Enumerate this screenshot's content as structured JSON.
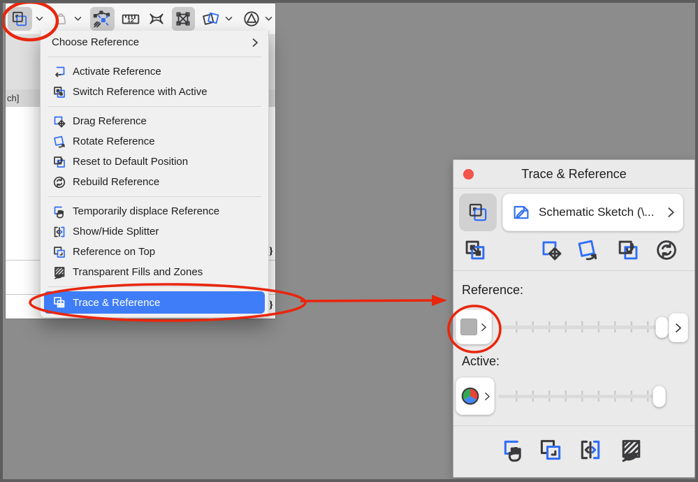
{
  "toolbar": {
    "buttons": [
      {
        "icon": "trace-reference-icon",
        "pressed": true
      },
      {
        "icon": "chevron-down-icon"
      },
      {
        "icon": "gravity-weight-icon",
        "disabled": true
      },
      {
        "icon": "chevron-down-icon"
      },
      {
        "icon": "virtual-trace-icon",
        "pressed": true
      },
      {
        "icon": "measure-icon",
        "measure_label": "12"
      },
      {
        "icon": "marquee-icon"
      },
      {
        "icon": "edit-handles-icon",
        "pressed": true
      },
      {
        "icon": "rotated-squares-icon"
      },
      {
        "icon": "chevron-down-icon"
      },
      {
        "icon": "orientation-circle-triangle-icon"
      },
      {
        "icon": "chevron-down-icon"
      }
    ],
    "measure_label": "12"
  },
  "canvas": {
    "tab_label": "ch]",
    "clipped_glyph_1": "}",
    "clipped_glyph_2": "}"
  },
  "menu": {
    "items": [
      {
        "label": "Choose Reference",
        "has_submenu": true
      },
      {
        "label": "Activate Reference",
        "icon": "activate-reference-icon"
      },
      {
        "label": "Switch Reference with Active",
        "icon": "switch-reference-icon"
      },
      {
        "label": "Drag Reference",
        "icon": "drag-reference-icon"
      },
      {
        "label": "Rotate Reference",
        "icon": "rotate-reference-icon"
      },
      {
        "label": "Reset to Default Position",
        "icon": "reset-position-icon"
      },
      {
        "label": "Rebuild Reference",
        "icon": "rebuild-reference-icon"
      },
      {
        "label": "Temporarily displace Reference",
        "icon": "displace-reference-icon"
      },
      {
        "label": "Show/Hide Splitter",
        "icon": "splitter-icon"
      },
      {
        "label": "Reference on Top",
        "icon": "reference-on-top-icon"
      },
      {
        "label": "Transparent Fills and Zones",
        "icon": "transparent-fills-icon"
      },
      {
        "label": "Trace & Reference",
        "icon": "trace-reference-icon",
        "highlighted": true
      }
    ],
    "highlight_color": "#3e7df7"
  },
  "palette": {
    "title": "Trace & Reference",
    "source_button": {
      "label": "Schematic Sketch (\\...",
      "icon": "sketch-document-icon"
    },
    "toggle_button": {
      "icon": "trace-reference-icon",
      "pressed": true
    },
    "action_icons": [
      "switch-reference-icon",
      "drag-reference-icon",
      "rotate-reference-icon",
      "reset-position-icon",
      "rebuild-reference-icon"
    ],
    "reference_label": "Reference:",
    "active_label": "Active:",
    "reference_slider": {
      "position_percent": 100
    },
    "active_slider": {
      "position_percent": 100
    },
    "reference_swatch_color": "#b2b1b1",
    "active_swatch": "color-pie-icon",
    "bottom_icons": [
      "displace-reference-icon",
      "reference-on-top-icon",
      "splitter-icon",
      "transparent-fills-icon"
    ],
    "close_dot_color": "#f4544b"
  },
  "annotations": {
    "color": "#e8260d",
    "shapes": [
      "ellipse-toolbar-trace-button",
      "ellipse-menu-trace-reference-item",
      "arrow-menu-to-palette",
      "ellipse-reference-swatch-button"
    ]
  }
}
